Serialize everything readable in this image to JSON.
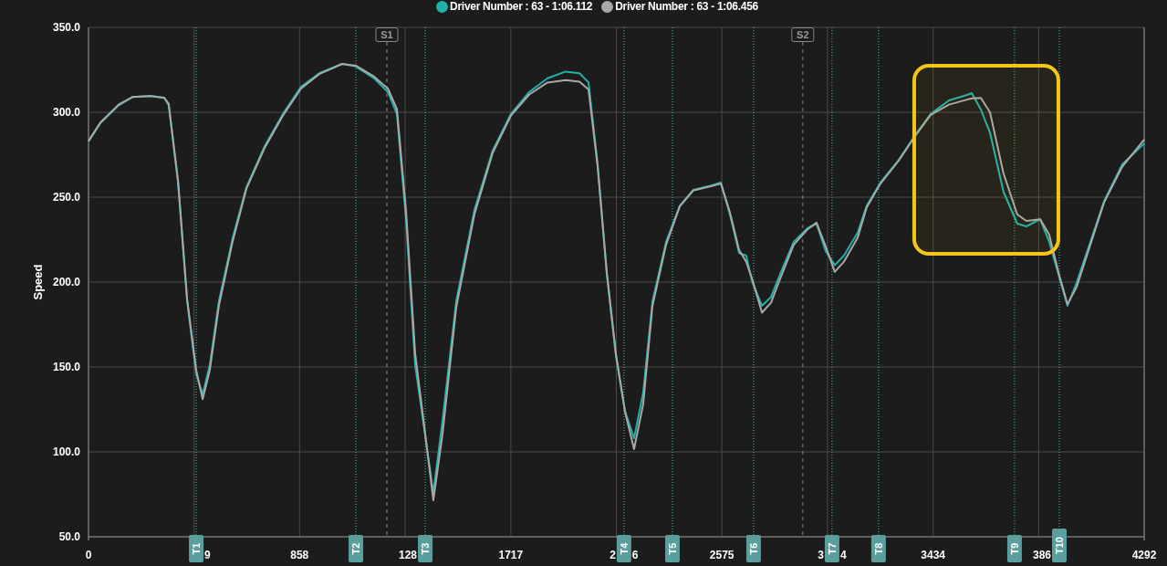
{
  "chart_data": {
    "type": "line",
    "ylabel": "Speed",
    "x": [
      0,
      48,
      122,
      178,
      252,
      308,
      326,
      364,
      401,
      438,
      464,
      493,
      530,
      586,
      642,
      716,
      790,
      864,
      938,
      1031,
      1087,
      1161,
      1217,
      1254,
      1291,
      1328,
      1365,
      1402,
      1439,
      1495,
      1569,
      1643,
      1717,
      1792,
      1866,
      1940,
      1996,
      2033,
      2070,
      2107,
      2144,
      2181,
      2218,
      2255,
      2293,
      2348,
      2404,
      2459,
      2534,
      2571,
      2608,
      2645,
      2674,
      2700,
      2738,
      2775,
      2812,
      2867,
      2923,
      2960,
      2997,
      3034,
      3071,
      3127,
      3164,
      3220,
      3294,
      3368,
      3424,
      3498,
      3572,
      3591,
      3628,
      3665,
      3720,
      3776,
      3813,
      3869,
      3906,
      3943,
      3980,
      4017,
      4073,
      4129,
      4203,
      4292
    ],
    "series": [
      {
        "name": "Driver Number : 63 - 1:06.112",
        "color": "#20b2aa",
        "values": [
          282.8,
          293.5,
          304,
          309,
          309.7,
          308.6,
          304,
          258.6,
          188.7,
          145.7,
          133.9,
          151,
          188.7,
          226,
          256,
          280,
          299,
          315,
          323,
          328.5,
          327,
          320,
          312,
          299,
          237,
          151,
          113.5,
          75.8,
          118,
          188.7,
          242.5,
          277.4,
          299,
          312,
          320,
          324,
          323,
          317.7,
          269.4,
          204.8,
          156.5,
          124.2,
          108,
          134.9,
          188.7,
          223.7,
          245,
          254.3,
          257,
          258.6,
          239.8,
          217.2,
          215.6,
          199.5,
          186,
          191.3,
          204.8,
          223.7,
          231.7,
          234.4,
          218.3,
          210,
          215.6,
          229,
          245,
          258.6,
          272,
          288,
          299,
          307,
          310.2,
          311.3,
          301.6,
          288,
          253.2,
          234.4,
          232.8,
          237,
          223.7,
          204.8,
          186,
          199.5,
          223.7,
          247.8,
          269.4,
          281.6
        ]
      },
      {
        "name": "Driver Number : 63 - 1:06.456",
        "color": "#a8a8a8",
        "values": [
          283,
          294,
          304.5,
          309,
          309.5,
          308.5,
          305,
          260,
          190,
          148,
          131,
          148,
          186,
          224,
          255,
          279,
          298,
          314,
          322.5,
          328.5,
          327.5,
          321,
          314,
          302,
          242,
          158,
          115,
          71.5,
          110,
          185,
          240,
          276,
          298,
          310.5,
          317.5,
          319,
          318,
          313.5,
          268,
          206,
          158,
          124,
          101.6,
          128,
          186,
          222,
          244.5,
          254,
          256.5,
          258,
          241,
          219,
          212,
          201,
          182,
          188,
          202,
          222,
          231,
          235,
          221,
          206,
          212,
          226,
          244,
          258,
          271.5,
          287.5,
          298.5,
          304.5,
          307.5,
          308.2,
          308.5,
          300,
          264,
          239.8,
          236,
          237,
          228,
          206,
          187,
          197,
          222,
          247,
          268,
          284
        ]
      }
    ],
    "xlim": [
      0,
      4292
    ],
    "ylim": [
      50,
      350
    ],
    "xticks": [
      {
        "value": 0,
        "label": "0"
      },
      {
        "value": 858,
        "label": "858"
      },
      {
        "value": 1717,
        "label": "1717"
      },
      {
        "value": 2575,
        "label": "2575"
      },
      {
        "value": 3434,
        "label": "3434"
      },
      {
        "value": 4292,
        "label": "4292"
      }
    ],
    "yticks": [
      {
        "value": 50,
        "label": "50.0"
      },
      {
        "value": 100,
        "label": "100.0"
      },
      {
        "value": 150,
        "label": "150.0"
      },
      {
        "value": 200,
        "label": "200.0"
      },
      {
        "value": 250,
        "label": "250.0"
      },
      {
        "value": 300,
        "label": "300.0"
      },
      {
        "value": 350,
        "label": "350.0"
      }
    ],
    "grid": true,
    "ref_lines": [
      {
        "axis": "x",
        "value": 438,
        "color": "#3fbfbf"
      },
      {
        "axis": "x",
        "value": 1087,
        "color": "#3fbfbf"
      },
      {
        "axis": "x",
        "value": 1213,
        "label": "S1",
        "color": "#8a8a8a"
      },
      {
        "axis": "x",
        "value": 1369,
        "color": "#3fbfbf"
      },
      {
        "axis": "x",
        "value": 2177,
        "color": "#3fbfbf"
      },
      {
        "axis": "x",
        "value": 2374,
        "color": "#3fbfbf"
      },
      {
        "axis": "x",
        "value": 2704,
        "color": "#3fbfbf"
      },
      {
        "axis": "x",
        "value": 2904,
        "label": "S2",
        "color": "#8a8a8a"
      },
      {
        "axis": "x",
        "value": 3023,
        "color": "#3fbfbf"
      },
      {
        "axis": "x",
        "value": 3212,
        "color": "#3fbfbf"
      },
      {
        "axis": "x",
        "value": 3765,
        "color": "#3fbfbf"
      },
      {
        "axis": "x",
        "value": 3947,
        "color": "#3fbfbf"
      }
    ],
    "bands": [
      {
        "axis": "x",
        "from": 3357,
        "to": 3943,
        "color": "#f5c518"
      }
    ]
  },
  "corner_badges": [
    {
      "label": "T1",
      "after": "9"
    },
    {
      "label": "T2"
    },
    {
      "label": "T3",
      "before": "128"
    },
    {
      "label": "T4",
      "before": "2",
      "after": "6"
    },
    {
      "label": "T5"
    },
    {
      "label": "T6"
    },
    {
      "label": "T7",
      "before": "3",
      "after": "4"
    },
    {
      "label": "T8"
    },
    {
      "label": "T9"
    },
    {
      "label": "T10",
      "before": "386"
    }
  ]
}
